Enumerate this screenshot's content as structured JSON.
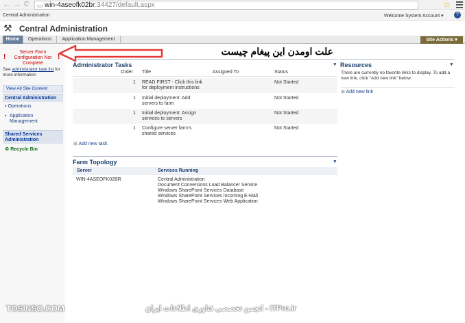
{
  "browser": {
    "url_host": "win-4aseofk02br",
    "url_path": ":34427/default.aspx",
    "back": "←",
    "forward": "→",
    "reload": "C",
    "star": "☆"
  },
  "top_strip": {
    "site_name": "Central Administration",
    "welcome": "Welcome System Account ▾"
  },
  "header": {
    "title": "Central Administration",
    "tabs": [
      "Home",
      "Operations",
      "Application Management"
    ],
    "site_actions": "Site Actions ▾"
  },
  "left_nav": {
    "warning_text": "Server Farm Configuration Not Complete",
    "see_text": "See",
    "task_link": "administrator task list",
    "more_info": "for more information",
    "view_all": "View All Site Content",
    "ca_header": "Central Administration",
    "ca_items": [
      "Operations",
      "Application Management"
    ],
    "ssa_header": "Shared Services Administration",
    "recycle_bin": "Recycle Bin"
  },
  "annotation": {
    "text": "علت اومدن این پیغام چیست"
  },
  "admin_tasks": {
    "title": "Administrator Tasks",
    "columns": [
      "Order",
      "Title",
      "Assigned To",
      "Status"
    ],
    "rows": [
      {
        "order": "1",
        "title": "READ FIRST - Click this link for deployment instructions",
        "assigned": "",
        "status": "Not Started"
      },
      {
        "order": "1",
        "title": "Initial deployment: Add servers to farm",
        "assigned": "",
        "status": "Not Started"
      },
      {
        "order": "1",
        "title": "Initial deployment: Assign services to servers",
        "assigned": "",
        "status": "Not Started"
      },
      {
        "order": "1",
        "title": "Configure server farm's shared services",
        "assigned": "",
        "status": "Not Started"
      }
    ],
    "add_new": "Add new task"
  },
  "farm_topology": {
    "title": "Farm Topology",
    "col_server": "Server",
    "col_services": "Services Running",
    "server": "WIN-4ASEOFK02BR",
    "services": [
      "Central Administration",
      "Document Conversions Load Balancer Service",
      "Windows SharePoint Services Database",
      "Windows SharePoint Services Incoming E-Mail",
      "Windows SharePoint Services Web Application"
    ]
  },
  "resources": {
    "title": "Resources",
    "message": "There are currently no favorite links to display. To add a new link, click \"Add new link\" below.",
    "add_new": "Add new link"
  },
  "footer": {
    "left": "TOSINSO.COM",
    "right": "ITPro.ir - انجمن تخصصی فناوری اطلاعات ایران"
  },
  "colors": {
    "accent": "#6b7f9e",
    "warning": "#cc0000",
    "site_actions": "#7a6c3a",
    "annotation_arrow": "#e53935"
  }
}
